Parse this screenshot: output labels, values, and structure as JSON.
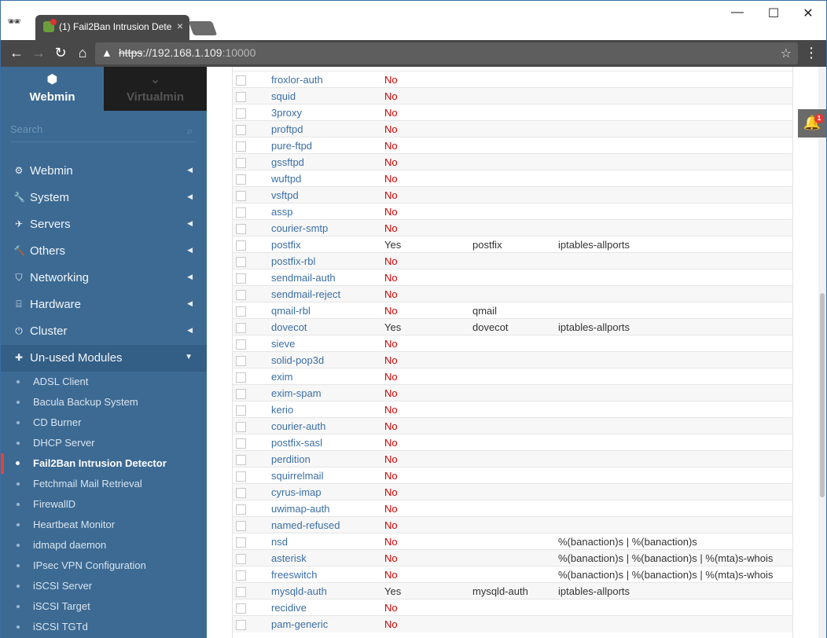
{
  "browser": {
    "tab_title": "(1) Fail2Ban Intrusion Dete",
    "tab_close": "×",
    "url_scheme": "https",
    "url_host": "://192.168.1.109",
    "url_port": ":10000",
    "minimize": "—",
    "maximize": "☐",
    "close": "✕",
    "back": "←",
    "forward": "→",
    "reload": "↻",
    "home": "⌂",
    "warning": "▲",
    "star": "☆",
    "menu": "⋮",
    "incognito": "🕶"
  },
  "sidebar": {
    "webmin_label": "Webmin",
    "virtualmin_label": "Virtualmin",
    "webmin_icon": "⬢",
    "virtualmin_icon": "⌄",
    "search_placeholder": "Search",
    "search_icon": "⌕",
    "menu": [
      {
        "label": "Webmin",
        "icon": "⚙"
      },
      {
        "label": "System",
        "icon": "🔧"
      },
      {
        "label": "Servers",
        "icon": "✈"
      },
      {
        "label": "Others",
        "icon": "🔨"
      },
      {
        "label": "Networking",
        "icon": "⛉"
      },
      {
        "label": "Hardware",
        "icon": "⌸"
      },
      {
        "label": "Cluster",
        "icon": "⏻"
      },
      {
        "label": "Un-used Modules",
        "icon": "✚"
      }
    ],
    "caret_closed": "◀",
    "caret_open": "▼",
    "sub_items": [
      "ADSL Client",
      "Bacula Backup System",
      "CD Burner",
      "DHCP Server",
      "Fail2Ban Intrusion Detector",
      "Fetchmail Mail Retrieval",
      "FirewallD",
      "Heartbeat Monitor",
      "idmapd daemon",
      "IPsec VPN Configuration",
      "iSCSI Server",
      "iSCSI Target",
      "iSCSI TGTd"
    ]
  },
  "notifications": {
    "icon": "🔔",
    "count": "1"
  },
  "jails": [
    {
      "name": "froxlor-auth",
      "enabled": "No",
      "filter": "",
      "action": ""
    },
    {
      "name": "squid",
      "enabled": "No",
      "filter": "",
      "action": ""
    },
    {
      "name": "3proxy",
      "enabled": "No",
      "filter": "",
      "action": ""
    },
    {
      "name": "proftpd",
      "enabled": "No",
      "filter": "",
      "action": ""
    },
    {
      "name": "pure-ftpd",
      "enabled": "No",
      "filter": "",
      "action": ""
    },
    {
      "name": "gssftpd",
      "enabled": "No",
      "filter": "",
      "action": ""
    },
    {
      "name": "wuftpd",
      "enabled": "No",
      "filter": "",
      "action": ""
    },
    {
      "name": "vsftpd",
      "enabled": "No",
      "filter": "",
      "action": ""
    },
    {
      "name": "assp",
      "enabled": "No",
      "filter": "",
      "action": ""
    },
    {
      "name": "courier-smtp",
      "enabled": "No",
      "filter": "",
      "action": ""
    },
    {
      "name": "postfix",
      "enabled": "Yes",
      "filter": "postfix",
      "action": "iptables-allports"
    },
    {
      "name": "postfix-rbl",
      "enabled": "No",
      "filter": "",
      "action": ""
    },
    {
      "name": "sendmail-auth",
      "enabled": "No",
      "filter": "",
      "action": ""
    },
    {
      "name": "sendmail-reject",
      "enabled": "No",
      "filter": "",
      "action": ""
    },
    {
      "name": "qmail-rbl",
      "enabled": "No",
      "filter": "qmail",
      "action": ""
    },
    {
      "name": "dovecot",
      "enabled": "Yes",
      "filter": "dovecot",
      "action": "iptables-allports"
    },
    {
      "name": "sieve",
      "enabled": "No",
      "filter": "",
      "action": ""
    },
    {
      "name": "solid-pop3d",
      "enabled": "No",
      "filter": "",
      "action": ""
    },
    {
      "name": "exim",
      "enabled": "No",
      "filter": "",
      "action": ""
    },
    {
      "name": "exim-spam",
      "enabled": "No",
      "filter": "",
      "action": ""
    },
    {
      "name": "kerio",
      "enabled": "No",
      "filter": "",
      "action": ""
    },
    {
      "name": "courier-auth",
      "enabled": "No",
      "filter": "",
      "action": ""
    },
    {
      "name": "postfix-sasl",
      "enabled": "No",
      "filter": "",
      "action": ""
    },
    {
      "name": "perdition",
      "enabled": "No",
      "filter": "",
      "action": ""
    },
    {
      "name": "squirrelmail",
      "enabled": "No",
      "filter": "",
      "action": ""
    },
    {
      "name": "cyrus-imap",
      "enabled": "No",
      "filter": "",
      "action": ""
    },
    {
      "name": "uwimap-auth",
      "enabled": "No",
      "filter": "",
      "action": ""
    },
    {
      "name": "named-refused",
      "enabled": "No",
      "filter": "",
      "action": ""
    },
    {
      "name": "nsd",
      "enabled": "No",
      "filter": "",
      "action": "%(banaction)s | %(banaction)s"
    },
    {
      "name": "asterisk",
      "enabled": "No",
      "filter": "",
      "action": "%(banaction)s | %(banaction)s | %(mta)s-whois"
    },
    {
      "name": "freeswitch",
      "enabled": "No",
      "filter": "",
      "action": "%(banaction)s | %(banaction)s | %(mta)s-whois"
    },
    {
      "name": "mysqld-auth",
      "enabled": "Yes",
      "filter": "mysqld-auth",
      "action": "iptables-allports"
    },
    {
      "name": "recidive",
      "enabled": "No",
      "filter": "",
      "action": ""
    },
    {
      "name": "pam-generic",
      "enabled": "No",
      "filter": "",
      "action": ""
    }
  ],
  "colors": {
    "sidebar_bg": "#3c6a93",
    "link": "#3b6fa6",
    "disabled_red": "#d40000",
    "active_marker": "#e0443a"
  }
}
